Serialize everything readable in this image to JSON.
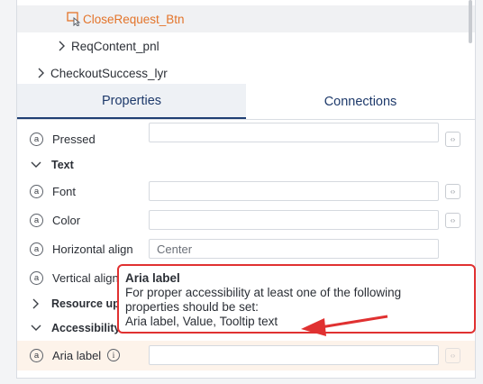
{
  "tree": {
    "items": [
      {
        "label": "CloseRequest_Btn",
        "icon": "click-cursor-icon",
        "selected": true
      },
      {
        "label": "ReqContent_pnl",
        "icon": "chevron-right-icon"
      },
      {
        "label": "CheckoutSuccess_lyr",
        "icon": "chevron-right-icon"
      }
    ]
  },
  "tabs": [
    {
      "label": "Properties",
      "active": true
    },
    {
      "label": "Connections",
      "active": false
    }
  ],
  "properties": {
    "pressed_label": "Pressed",
    "text_section": "Text",
    "font_label": "Font",
    "color_label": "Color",
    "halign_label": "Horizontal align",
    "halign_value": "Center",
    "valign_label": "Vertical align",
    "resource_section": "Resource update",
    "accessibility_section": "Accessibility",
    "aria_label": "Aria label",
    "aria_info_icon": "info-icon",
    "attr_icon_glyph": "a",
    "code_icon_glyph": "‹›"
  },
  "tooltip": {
    "title": "Aria label",
    "line1": "For proper accessibility at least one of the following",
    "line2": "properties should be set:",
    "line3": "Aria label, Value, Tooltip text"
  },
  "colors": {
    "accent_orange": "#e3742a",
    "tab_active_text": "#1e3a6b",
    "tooltip_border": "#e03131",
    "arrow_red": "#e03131"
  }
}
